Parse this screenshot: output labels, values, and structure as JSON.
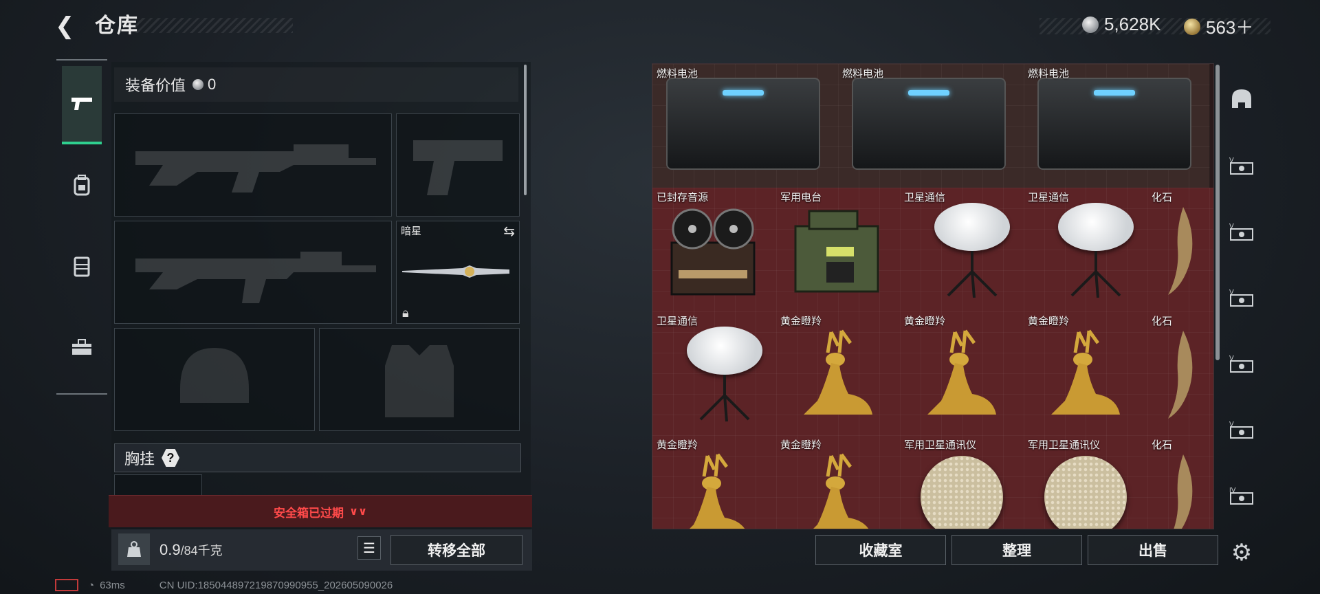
{
  "header": {
    "title": "仓库",
    "currency": [
      {
        "icon": "silver-coin-icon",
        "value": "5,628K"
      },
      {
        "icon": "gold-coin-icon",
        "value": "563＋"
      }
    ]
  },
  "tabs": [
    {
      "icon": "pistol-icon",
      "active": true
    },
    {
      "icon": "backpack-icon",
      "active": false
    },
    {
      "icon": "vest-icon",
      "active": false
    },
    {
      "icon": "toolbox-icon",
      "active": false
    }
  ],
  "loadout": {
    "value_label": "装备价值",
    "value": "0",
    "melee_name": "暗星",
    "chest_label": "胸挂",
    "chest_help": "?",
    "safe_status": "安全箱已过期",
    "weight_current": "0.9",
    "weight_max": "/84千克",
    "transfer_all": "转移全部"
  },
  "inventory": {
    "items": [
      {
        "name": "燃料电池",
        "kind": "battery"
      },
      {
        "name": "燃料电池",
        "kind": "battery"
      },
      {
        "name": "燃料电池",
        "kind": "battery"
      },
      {
        "name": "已封存音源",
        "kind": "reel"
      },
      {
        "name": "军用电台",
        "kind": "radio"
      },
      {
        "name": "卫星通信",
        "kind": "dish"
      },
      {
        "name": "卫星通信",
        "kind": "dish"
      },
      {
        "name": "化石",
        "kind": "claw"
      },
      {
        "name": "卫星通信",
        "kind": "dish"
      },
      {
        "name": "黄金瞪羚",
        "kind": "deer"
      },
      {
        "name": "黄金瞪羚",
        "kind": "deer"
      },
      {
        "name": "黄金瞪羚",
        "kind": "deer"
      },
      {
        "name": "化石",
        "kind": "claw"
      },
      {
        "name": "黄金瞪羚",
        "kind": "deer"
      },
      {
        "name": "黄金瞪羚",
        "kind": "deer"
      },
      {
        "name": "军用卫星通讯仪",
        "kind": "mesh"
      },
      {
        "name": "军用卫星通讯仪",
        "kind": "mesh"
      },
      {
        "name": "化石",
        "kind": "claw"
      }
    ]
  },
  "side_icons": [
    "helmet-icon",
    "case-v-icon",
    "case-v-icon",
    "case-v-icon",
    "case-v-icon",
    "case-v-icon",
    "case-iv-icon",
    "settings-icon"
  ],
  "buttons": {
    "collection": "收藏室",
    "sort": "整理",
    "sell": "出售"
  },
  "status": {
    "ping": "63ms",
    "uid": "CN UID:18504489721987099095​5_202605090026"
  }
}
